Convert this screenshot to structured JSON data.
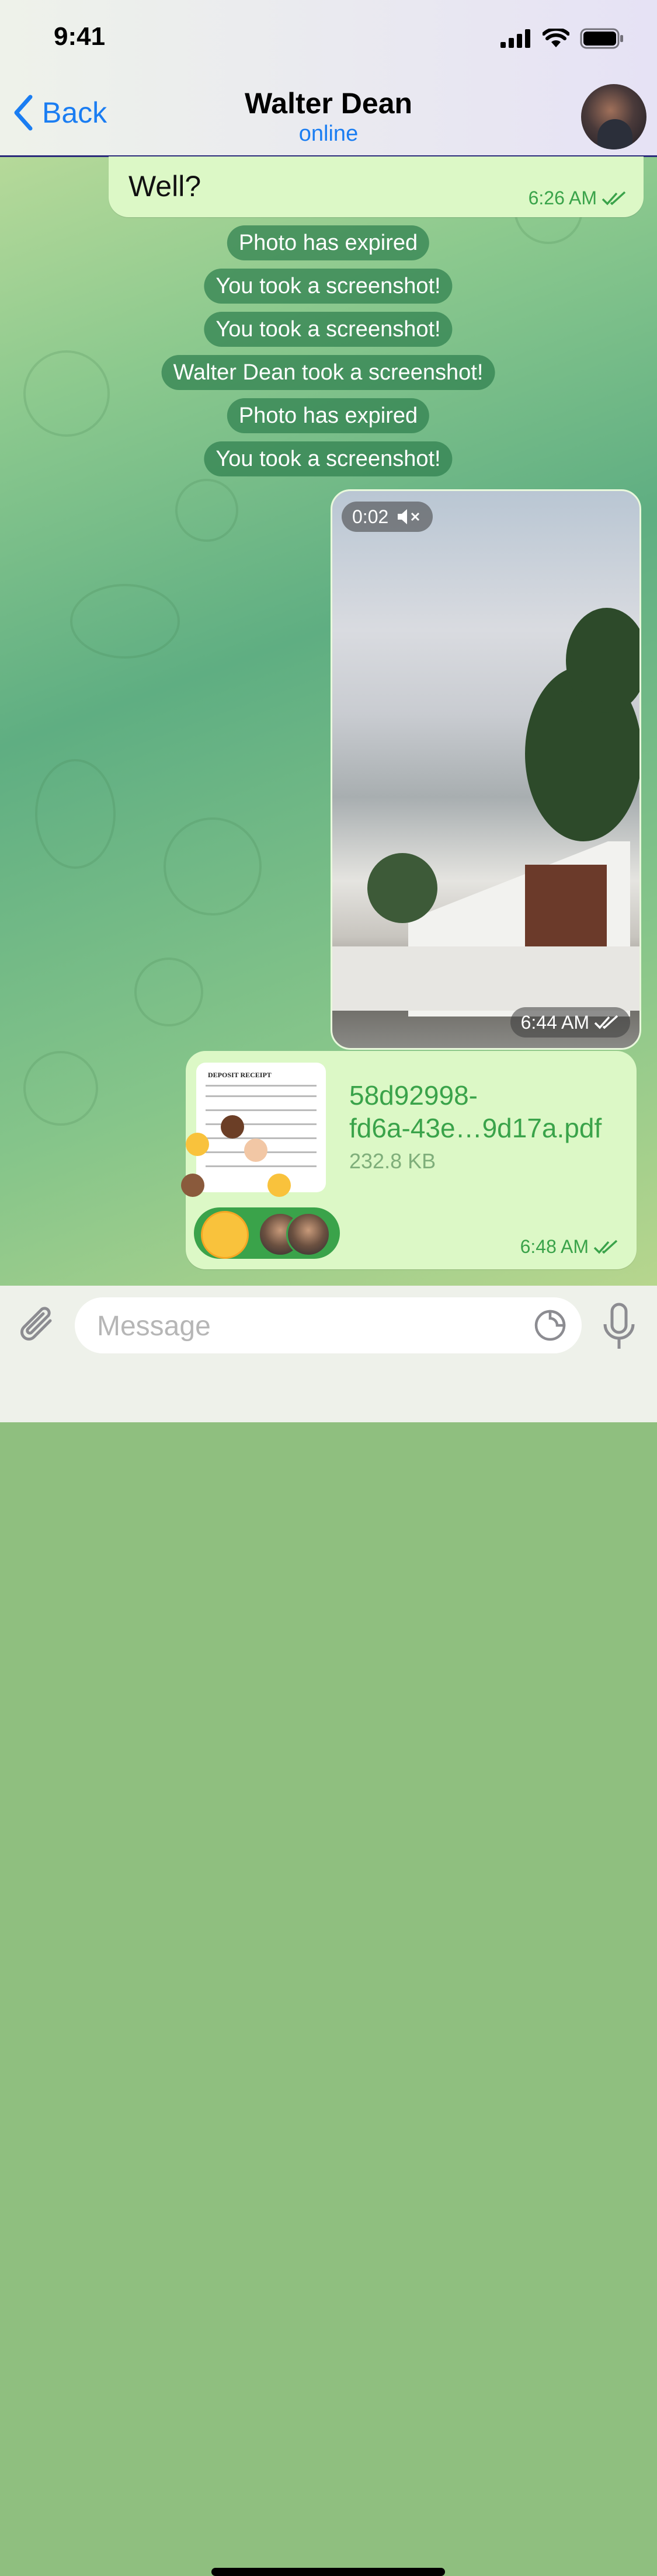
{
  "status_bar": {
    "time": "9:41"
  },
  "header": {
    "back_label": "Back",
    "contact_name": "Walter Dean",
    "contact_status": "online"
  },
  "messages": {
    "last_text": {
      "text": "Well?",
      "time": "6:26 AM"
    },
    "service": [
      "Photo has expired",
      "You took a screenshot!",
      "You took a screenshot!",
      "Walter Dean took a screenshot!",
      "Photo has expired",
      "You took a screenshot!"
    ],
    "video": {
      "duration": "0:02",
      "time": "6:44 AM"
    },
    "file": {
      "name": "58d92998-\nfd6a-43e…9d17a.pdf",
      "size": "232.8 KB",
      "time": "6:48 AM",
      "thumb_title": "DEPOSIT RECEIPT"
    }
  },
  "composer": {
    "placeholder": "Message"
  },
  "colors": {
    "accent": "#1a7df2",
    "outgoing_bubble": "#dcf8c6",
    "read_check": "#3aa34a"
  }
}
